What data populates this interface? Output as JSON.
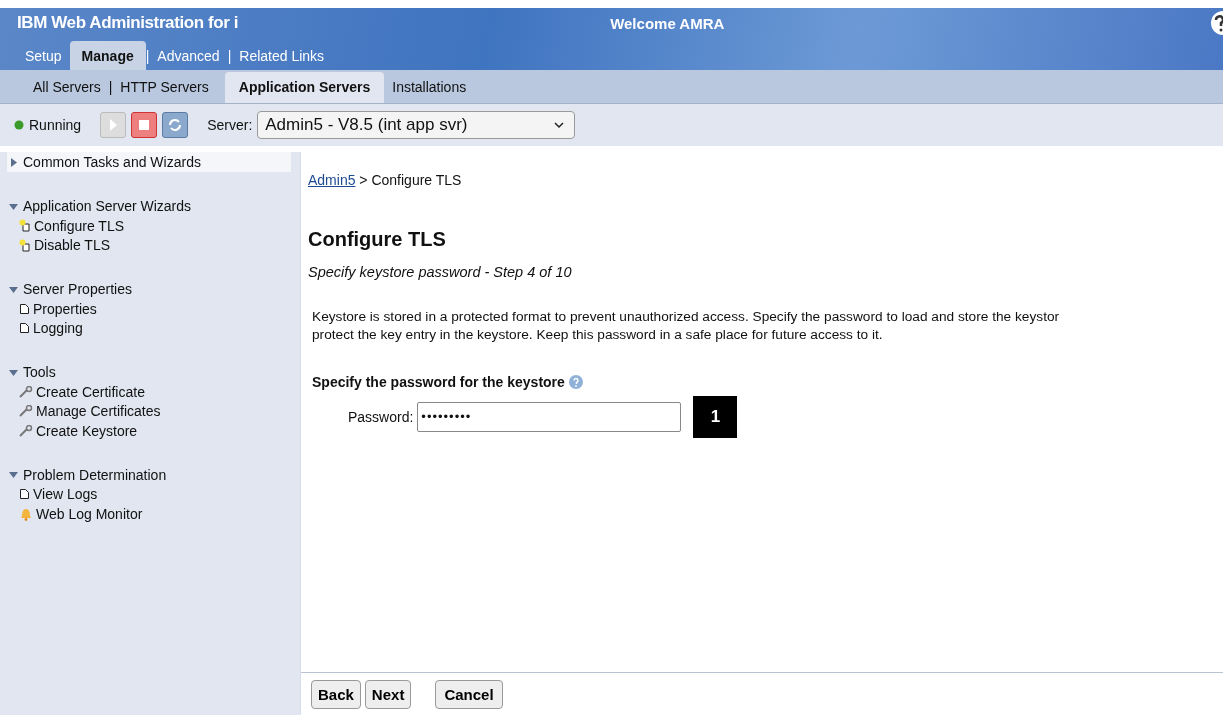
{
  "header": {
    "title": "IBM Web Administration for i",
    "welcome": "Welcome  AMRA"
  },
  "tab_separator": "|",
  "main_tabs": [
    {
      "label": "Setup",
      "selected": false
    },
    {
      "label": "Manage",
      "selected": true
    },
    {
      "label": "Advanced",
      "selected": false
    },
    {
      "label": "Related Links",
      "selected": false
    }
  ],
  "sub_tabs": [
    {
      "label": "All Servers",
      "selected": false
    },
    {
      "label": "HTTP Servers",
      "selected": false
    },
    {
      "label": "Application Servers",
      "selected": true
    },
    {
      "label": "Installations",
      "selected": false
    }
  ],
  "toolbar": {
    "status": "Running",
    "server_label": "Server:",
    "server_value": "Admin5 - V8.5 (int app svr)"
  },
  "sidebar": [
    {
      "title": "Common Tasks and Wizards",
      "expanded": false
    },
    {
      "title": "Application Server Wizards",
      "expanded": true,
      "items": [
        {
          "label": "Configure TLS",
          "kind": "wizard"
        },
        {
          "label": "Disable TLS",
          "kind": "wizard"
        }
      ]
    },
    {
      "title": "Server Properties",
      "expanded": true,
      "items": [
        {
          "label": "Properties",
          "kind": "page"
        },
        {
          "label": "Logging",
          "kind": "page"
        }
      ]
    },
    {
      "title": "Tools",
      "expanded": true,
      "items": [
        {
          "label": "Create Certificate",
          "kind": "tool"
        },
        {
          "label": "Manage Certificates",
          "kind": "tool"
        },
        {
          "label": "Create Keystore",
          "kind": "tool"
        }
      ]
    },
    {
      "title": "Problem Determination",
      "expanded": true,
      "items": [
        {
          "label": "View Logs",
          "kind": "page"
        },
        {
          "label": "Web Log Monitor",
          "kind": "monitor"
        }
      ]
    }
  ],
  "breadcrumb": {
    "link": "Admin5",
    "current": "> Configure TLS"
  },
  "page_title": "Configure TLS",
  "subtitle": "Specify keystore password - Step 4 of 10",
  "description": [
    "Keystore is stored in a protected format to prevent unauthorized access. Specify the password to load and store the keystor",
    "protect the key entry in the keystore. Keep this password in a safe place for future access to it."
  ],
  "section_title": "Specify the password for the keystore",
  "password": {
    "label": "Password:",
    "value": "•••••••••"
  },
  "callout": "1",
  "buttons": [
    "Back",
    "Next",
    "Cancel"
  ]
}
